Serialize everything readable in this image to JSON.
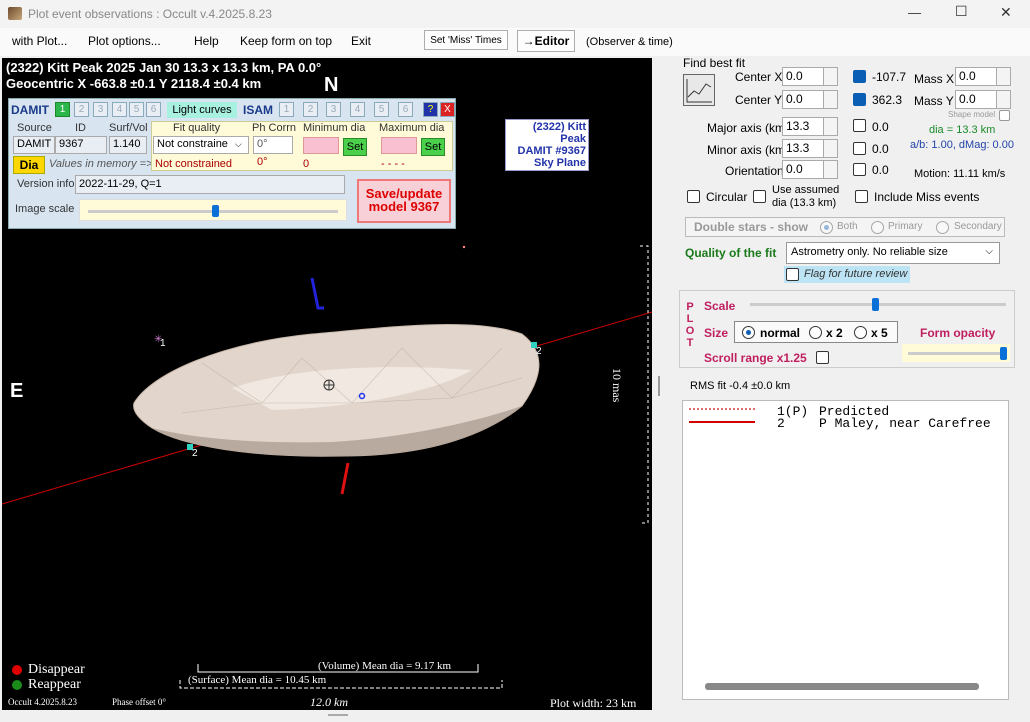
{
  "window": {
    "title": "Plot event observations : Occult v.4.2025.8.23",
    "min": "—",
    "max": "☐",
    "close": "✕"
  },
  "menu": {
    "with_plot": "with Plot...",
    "plot_options": "Plot options...",
    "help": "Help",
    "keep_on_top": "Keep form on top",
    "exit": "Exit",
    "set_miss": "Set 'Miss' Times",
    "editor": "→Editor",
    "observer_time": "(Observer & time)"
  },
  "plot": {
    "header1": "(2322) Kitt Peak  2025 Jan 30  13.3 x 13.3 km, PA 0.0°",
    "header2": "Geocentric  X  -663.8 ±0.1  Y 2118.4 ±0.4 km",
    "north": "N",
    "east": "E",
    "scale_label": "10 mas",
    "info1": "(2322) Kitt Peak",
    "info2": "DAMIT #9367",
    "info3": "Sky Plane",
    "chord1a": "1",
    "chord2a": "2",
    "chord2b": "2",
    "legend_disappear": "Disappear",
    "legend_reappear": "Reappear",
    "volume_dia": "(Volume) Mean dia = 9.17 km",
    "surface_dia": "(Surface) Mean dia = 10.45 km",
    "scale_km": "12.0 km",
    "version": "Occult 4.2025.8.23",
    "phase_offset": "Phase offset 0°",
    "plot_width": "Plot width: 23 km",
    "colors": {
      "disappear": "#e00000",
      "reappear": "#1a8a1a",
      "chord": "#d00000",
      "shape": "#e4d8cf"
    }
  },
  "damit": {
    "damit_label": "DAMIT",
    "tab1": "1",
    "tabs": [
      "2",
      "3",
      "4",
      "5",
      "6"
    ],
    "light_curves": "Light curves",
    "isam_label": "ISAM",
    "isam_tabs": [
      "1",
      "2",
      "3",
      "4",
      "5",
      "6"
    ],
    "help": "?",
    "close": "X",
    "source_hdr": "Source",
    "id_hdr": "ID",
    "surf_hdr": "Surf/Vol",
    "source": "DAMIT",
    "id": "9367",
    "surf_vol": "1.140",
    "dia_btn": "Dia",
    "values_in_memory": "Values in memory =>",
    "fit_quality_hdr": "Fit quality",
    "fit_quality": "Not constraine",
    "fit_quality_mem": "Not constrained",
    "ph_corr_hdr": "Ph Corrn",
    "ph_corr": "0°",
    "ph_corr_mem": "0°",
    "min_dia_hdr": "Minimum dia",
    "min_dia_mem": "0",
    "max_dia_hdr": "Maximum dia",
    "max_dia_mem": "- - - -",
    "set": "Set",
    "version_label": "Version info",
    "version": "2022-11-29, Q=1",
    "image_scale": "Image scale",
    "save_btn": "Save/update model 9367"
  },
  "fit": {
    "title": "Find best fit",
    "center_x": "Center X",
    "center_x_val": "0.0",
    "center_y": "Center Y",
    "center_y_val": "0.0",
    "cx_result": "-107.7",
    "cy_result": "362.3",
    "mass_x": "Mass X",
    "mass_x_val": "0.0",
    "mass_y": "Mass Y",
    "mass_y_val": "0.0",
    "shape_model": "Shape model",
    "major": "Major axis (km)",
    "major_val": "13.3",
    "major_res": "0.0",
    "minor": "Minor axis (km)",
    "minor_val": "13.3",
    "minor_res": "0.0",
    "orient": "Orientation",
    "orient_val": "0.0",
    "orient_res": "0.0",
    "dia": "dia = 13.3 km",
    "ab": "a/b: 1.00, dMag: 0.00",
    "motion": "Motion: 11.11 km/s",
    "circular": "Circular",
    "assumed_dia": "Use assumed dia (13.3 km)",
    "include_miss": "Include Miss events",
    "double_stars": "Double stars - show",
    "both": "Both",
    "primary": "Primary",
    "secondary": "Secondary",
    "quality_label": "Quality of the fit",
    "quality_val": "Astrometry only. No reliable size",
    "flag_review": "Flag for future review",
    "plot_letters": [
      "P",
      "L",
      "O",
      "T"
    ],
    "scale": "Scale",
    "size": "Size",
    "normal": "normal",
    "x2": "x 2",
    "x5": "x 5",
    "form_opacity": "Form opacity",
    "scroll_range": "Scroll range x1.25",
    "rms": "RMS fit -0.4 ±0.0 km"
  },
  "legend_list": [
    {
      "num": "1(P)",
      "name": "Predicted"
    },
    {
      "num": "2",
      "name": "P Maley, near Carefree"
    }
  ]
}
